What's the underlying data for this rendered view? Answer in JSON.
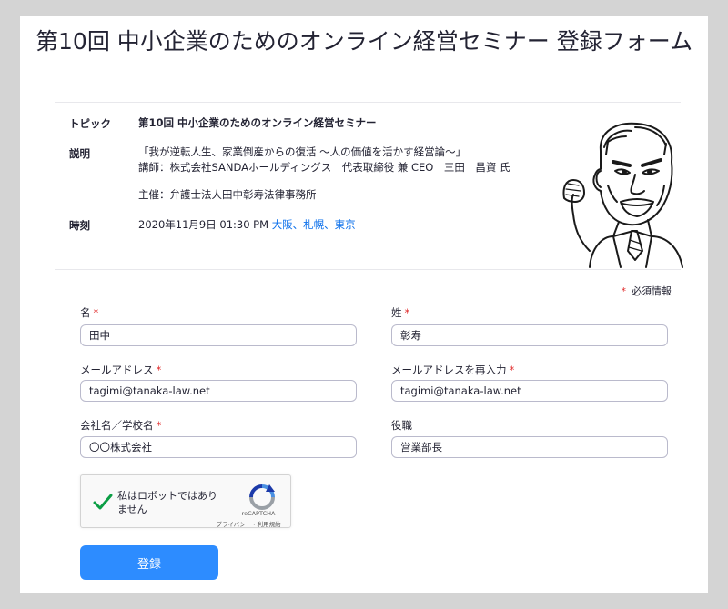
{
  "page": {
    "title": "第10回 中小企業のためのオンライン経営セミナー 登録フォーム"
  },
  "info": {
    "topic_label": "トピック",
    "topic_value": "第10回 中小企業のためのオンライン経営セミナー",
    "description_label": "説明",
    "description_line1": "「我が逆転人生、家業倒産からの復活 ～人の価値を活かす経営論～」",
    "description_line2": "講師：株式会社SANDAホールディングス　代表取締役 兼 CEO　三田　昌資 氏",
    "description_line3": "主催：弁護士法人田中彰寿法律事務所",
    "time_label": "時刻",
    "time_value": "2020年11月9日 01:30 PM",
    "time_zone": "大阪、札幌、東京"
  },
  "form": {
    "required_note": "必須情報",
    "required_mark": "*",
    "first_name_label": "名",
    "first_name_value": "田中",
    "last_name_label": "姓",
    "last_name_value": "彰寿",
    "email_label": "メールアドレス",
    "email_value": "tagimi@tanaka-law.net",
    "email_confirm_label": "メールアドレスを再入力",
    "email_confirm_value": "tagimi@tanaka-law.net",
    "company_label": "会社名／学校名",
    "company_value": "〇〇株式会社",
    "job_title_label": "役職",
    "job_title_value": "営業部長",
    "submit_label": "登録"
  },
  "captcha": {
    "text": "私はロボットではありません",
    "brand": "reCAPTCHA",
    "links": "プライバシー・利用規約",
    "checked": true
  },
  "colors": {
    "accent": "#2d8cff",
    "link": "#0e71eb",
    "required": "#e02828",
    "check": "#0b9e45"
  }
}
